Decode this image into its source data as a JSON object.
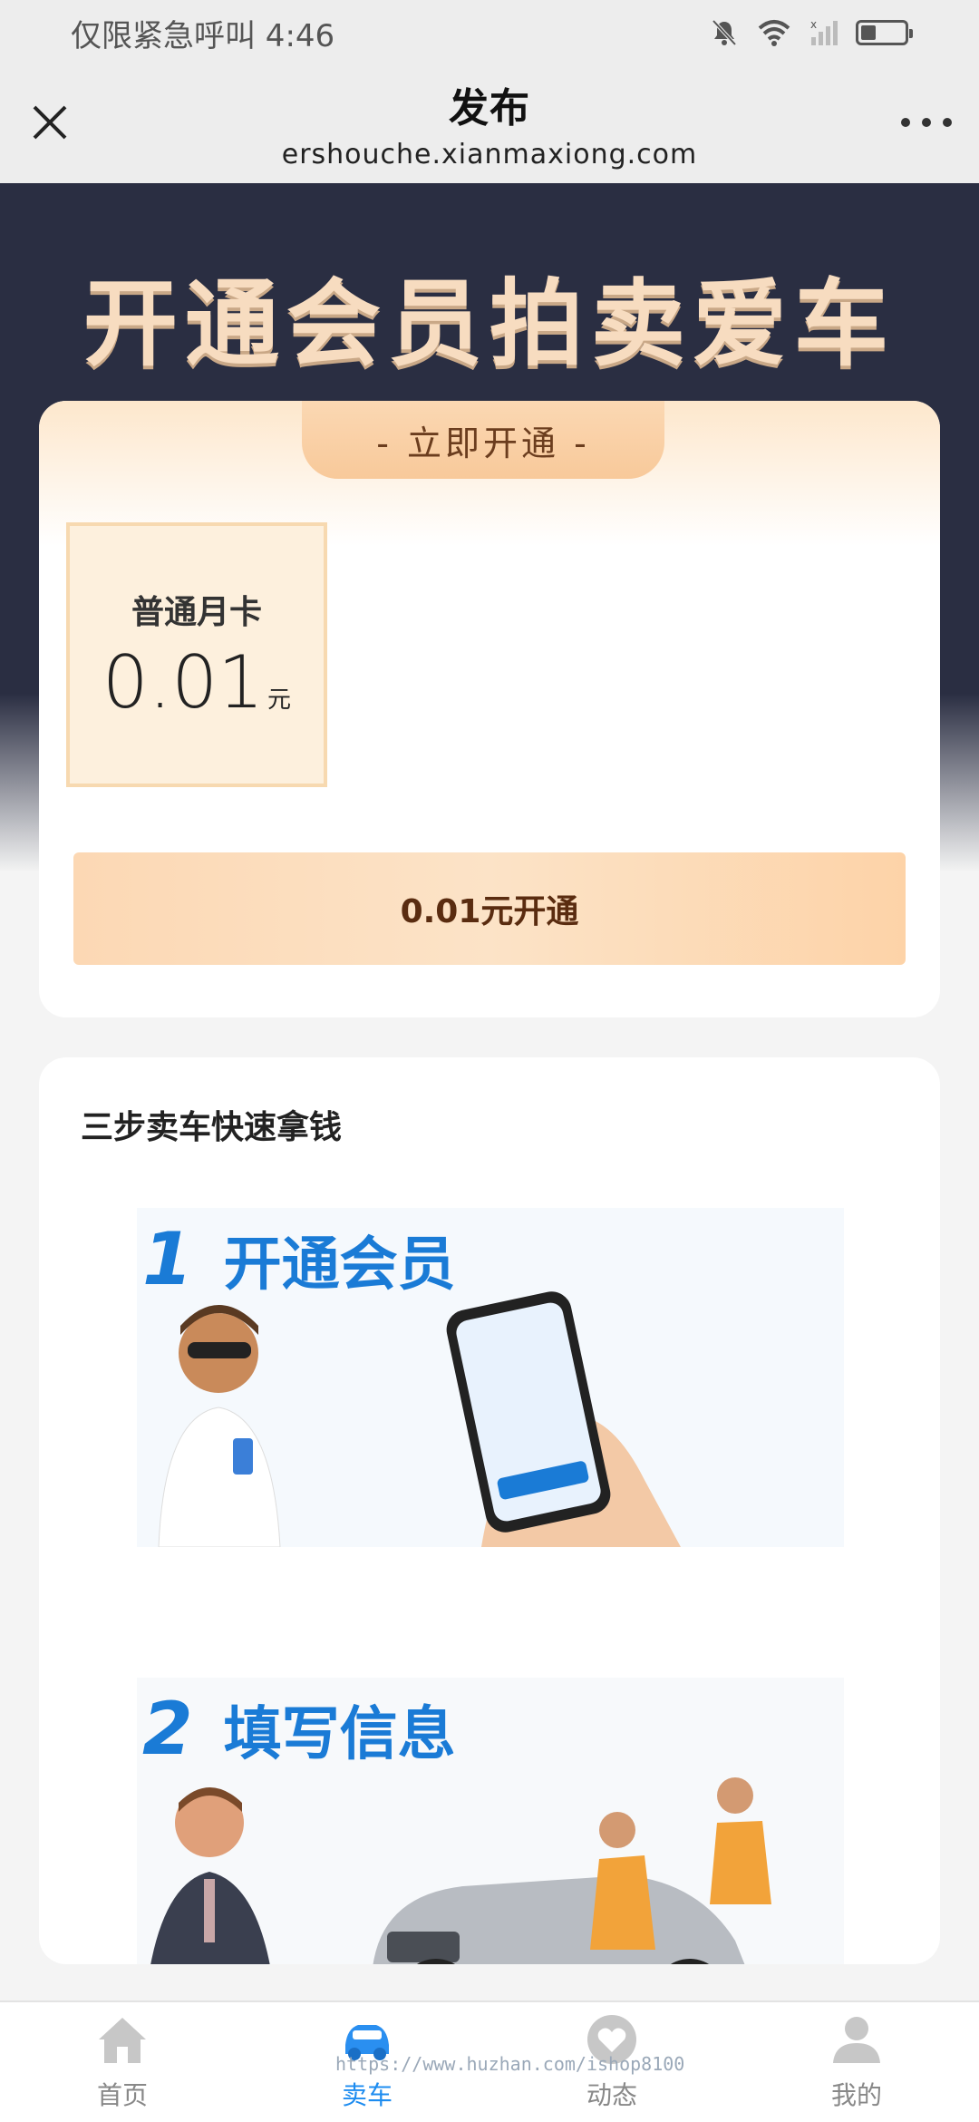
{
  "status_bar": {
    "left_text": "仅限紧急呼叫 4:46"
  },
  "nav": {
    "title": "发布",
    "url": "ershouche.xianmaxiong.com"
  },
  "hero": {
    "title": "开通会员拍卖爱车"
  },
  "membership": {
    "tab_label": "-  立即开通  -",
    "plan_name": "普通月卡",
    "plan_price": "0.01",
    "plan_unit": "元",
    "open_button_label": "0.01元开通"
  },
  "steps": {
    "title": "三步卖车快速拿钱",
    "items": [
      {
        "number": "1",
        "label": "开通会员"
      },
      {
        "number": "2",
        "label": "填写信息"
      }
    ]
  },
  "tabs": [
    {
      "label": "首页",
      "icon": "home-icon",
      "active": false
    },
    {
      "label": "卖车",
      "icon": "car-icon",
      "active": true
    },
    {
      "label": "动态",
      "icon": "heart-icon",
      "active": false
    },
    {
      "label": "我的",
      "icon": "user-icon",
      "active": false
    }
  ],
  "watermark": "https://www.huzhan.com/ishop8100",
  "colors": {
    "hero_bg": "#2a2e42",
    "accent_gold": "#f7dcc0",
    "active_tab": "#1d8cf0",
    "step_blue": "#1a7bd6"
  }
}
